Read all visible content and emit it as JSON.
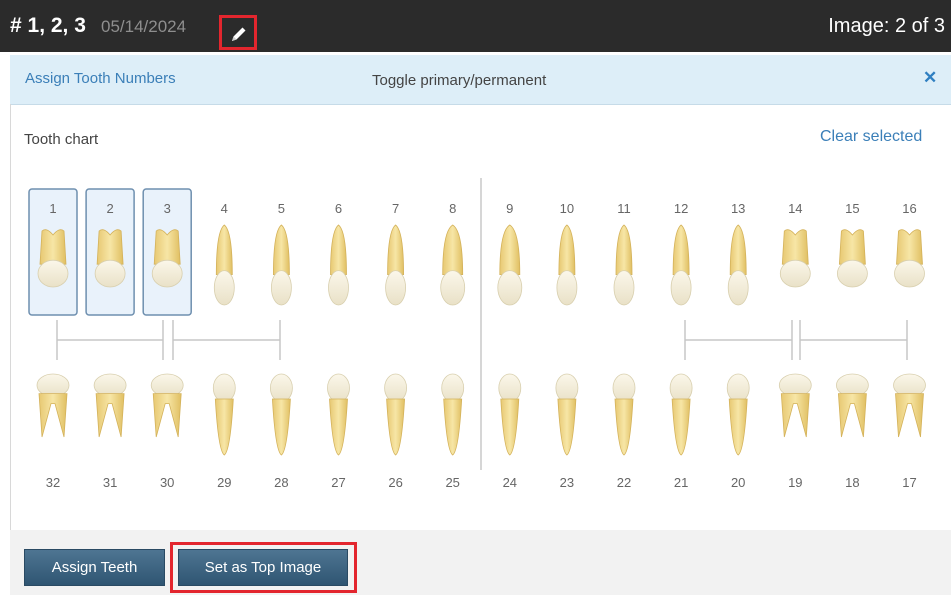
{
  "header": {
    "teeth_label": "# 1, 2, 3",
    "date": "05/14/2024",
    "edit_icon": "pencil-icon",
    "image_counter": "Image: 2 of 3"
  },
  "assign_bar": {
    "title": "Assign Tooth Numbers",
    "toggle_label": "Toggle primary/permanent",
    "close_label": "✕"
  },
  "chart": {
    "label": "Tooth chart",
    "clear_label": "Clear selected",
    "upper_numbers": [
      "1",
      "2",
      "3",
      "4",
      "5",
      "6",
      "7",
      "8",
      "9",
      "10",
      "11",
      "12",
      "13",
      "14",
      "15",
      "16"
    ],
    "lower_numbers": [
      "32",
      "31",
      "30",
      "29",
      "28",
      "27",
      "26",
      "25",
      "24",
      "23",
      "22",
      "21",
      "20",
      "19",
      "18",
      "17"
    ],
    "selected": [
      "1",
      "2",
      "3"
    ]
  },
  "buttons": {
    "assign_teeth": "Assign Teeth",
    "set_top_image": "Set as Top Image"
  },
  "colors": {
    "topbar": "#2b2b2b",
    "assign_bar": "#ddeef8",
    "selected_fill": "#e9f2fb",
    "selected_border": "#6e8faf",
    "highlight": "#e3262e",
    "button": "#3f6684"
  }
}
